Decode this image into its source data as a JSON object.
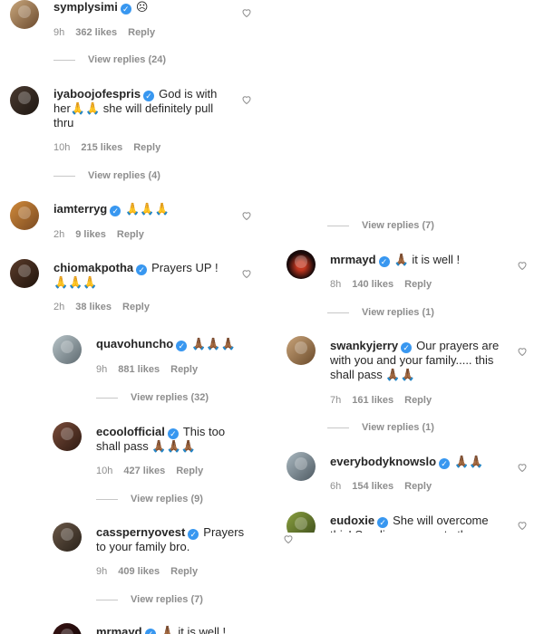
{
  "left": {
    "c1": {
      "user": "symplysimi",
      "text": "☹",
      "time": "9h",
      "likes": "362 likes",
      "reply": "Reply",
      "view": "View replies (24)"
    },
    "c2": {
      "user": "iyaboojofespris",
      "text": "God is with her🙏🙏 she will definitely pull thru",
      "time": "10h",
      "likes": "215 likes",
      "reply": "Reply",
      "view": "View replies (4)"
    },
    "c3": {
      "user": "iamterryg",
      "text": "🙏🙏🙏",
      "time": "2h",
      "likes": "9 likes",
      "reply": "Reply"
    },
    "c4": {
      "user": "chiomakpotha",
      "text": "Prayers UP ! 🙏🙏🙏",
      "time": "2h",
      "likes": "38 likes",
      "reply": "Reply"
    },
    "r1": {
      "user": "quavohuncho",
      "text": "🙏🏾🙏🏾🙏🏾",
      "time": "9h",
      "likes": "881 likes",
      "reply": "Reply",
      "view": "View replies (32)"
    },
    "r2": {
      "user": "ecoolofficial",
      "text": "This too shall pass 🙏🏾🙏🏾🙏🏾",
      "time": "10h",
      "likes": "427 likes",
      "reply": "Reply",
      "view": "View replies (9)"
    },
    "r3": {
      "user": "casspernyovest",
      "text": "Prayers to your family bro.",
      "time": "9h",
      "likes": "409 likes",
      "reply": "Reply",
      "view": "View replies (7)"
    },
    "r4": {
      "user": "mrmayd",
      "text": "🙏🏾 it is well !"
    }
  },
  "right": {
    "v0": "View replies (7)",
    "c1": {
      "user": "mrmayd",
      "text": "🙏🏾 it is well !",
      "time": "8h",
      "likes": "140 likes",
      "reply": "Reply",
      "view": "View replies (1)"
    },
    "c2": {
      "user": "swankyjerry",
      "text": "Our prayers are with you and your family..... this shall pass 🙏🏾🙏🏾",
      "time": "7h",
      "likes": "161 likes",
      "reply": "Reply",
      "view": "View replies (1)"
    },
    "c3": {
      "user": "everybodyknowslo",
      "text": "🙏🏾🙏🏾",
      "time": "6h",
      "likes": "154 likes",
      "reply": "Reply"
    },
    "c4": {
      "user": "eudoxie",
      "text": "She will overcome this! Sending prayers to the"
    }
  },
  "colors": {
    "verified": "#3897f0",
    "meta": "#8e8e8e",
    "text": "#262626"
  }
}
